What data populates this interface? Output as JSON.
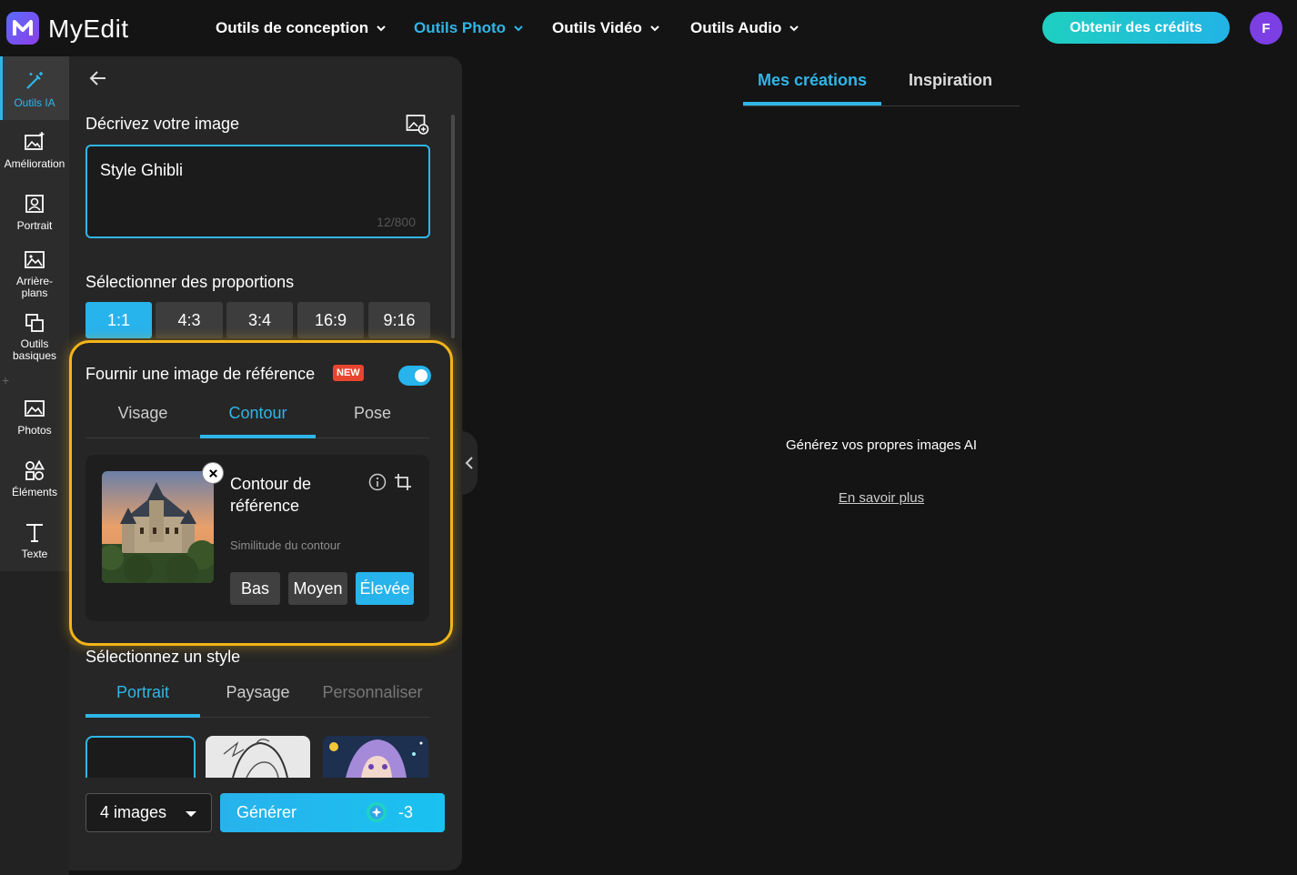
{
  "app": {
    "name": "MyEdit"
  },
  "nav": {
    "items": [
      {
        "label": "Outils de conception",
        "active": false
      },
      {
        "label": "Outils Photo",
        "active": true
      },
      {
        "label": "Outils Vidéo",
        "active": false
      },
      {
        "label": "Outils Audio",
        "active": false
      }
    ],
    "credits_button": "Obtenir des crédits",
    "avatar_initial": "F"
  },
  "rail": {
    "items": [
      {
        "label": "Outils IA",
        "icon": "magic-wand-icon",
        "active": true
      },
      {
        "label": "Amélioration",
        "icon": "image-enhance-icon"
      },
      {
        "label": "Portrait",
        "icon": "portrait-icon"
      },
      {
        "label": "Arrière-plans",
        "icon": "background-icon"
      },
      {
        "label": "Outils basiques",
        "icon": "crop-tools-icon"
      },
      {
        "label": "Photos",
        "icon": "photos-icon"
      },
      {
        "label": "Éléments",
        "icon": "elements-icon"
      },
      {
        "label": "Texte",
        "icon": "text-icon"
      }
    ],
    "plus": "+"
  },
  "panel": {
    "describe_title": "Décrivez votre image",
    "prompt_value": "Style Ghibli",
    "prompt_count": "12/800",
    "proportions_title": "Sélectionner des proportions",
    "ratios": [
      "1:1",
      "4:3",
      "3:4",
      "16:9",
      "9:16"
    ],
    "ratio_selected": "1:1",
    "reference": {
      "title": "Fournir une image de référence",
      "badge": "NEW",
      "enabled": true,
      "tabs": [
        "Visage",
        "Contour",
        "Pose"
      ],
      "active_tab": "Contour",
      "card_title": "Contour de référence",
      "similarity_label": "Similitude du contour",
      "similarity_options": [
        "Bas",
        "Moyen",
        "Élevée"
      ],
      "similarity_selected": "Élevée"
    },
    "style": {
      "title": "Sélectionnez un style",
      "tabs": [
        "Portrait",
        "Paysage",
        "Personnaliser"
      ],
      "active_tab": "Portrait"
    },
    "image_count": "4 images",
    "generate_label": "Générer",
    "generate_cost": "-3"
  },
  "main": {
    "tabs": [
      "Mes créations",
      "Inspiration"
    ],
    "active_tab": "Mes créations",
    "empty_message": "Générez vos propres images AI",
    "learn_more": "En savoir plus"
  },
  "colors": {
    "accent": "#2fb6e8",
    "highlight": "#f4b41a",
    "badge": "#e8452f"
  }
}
